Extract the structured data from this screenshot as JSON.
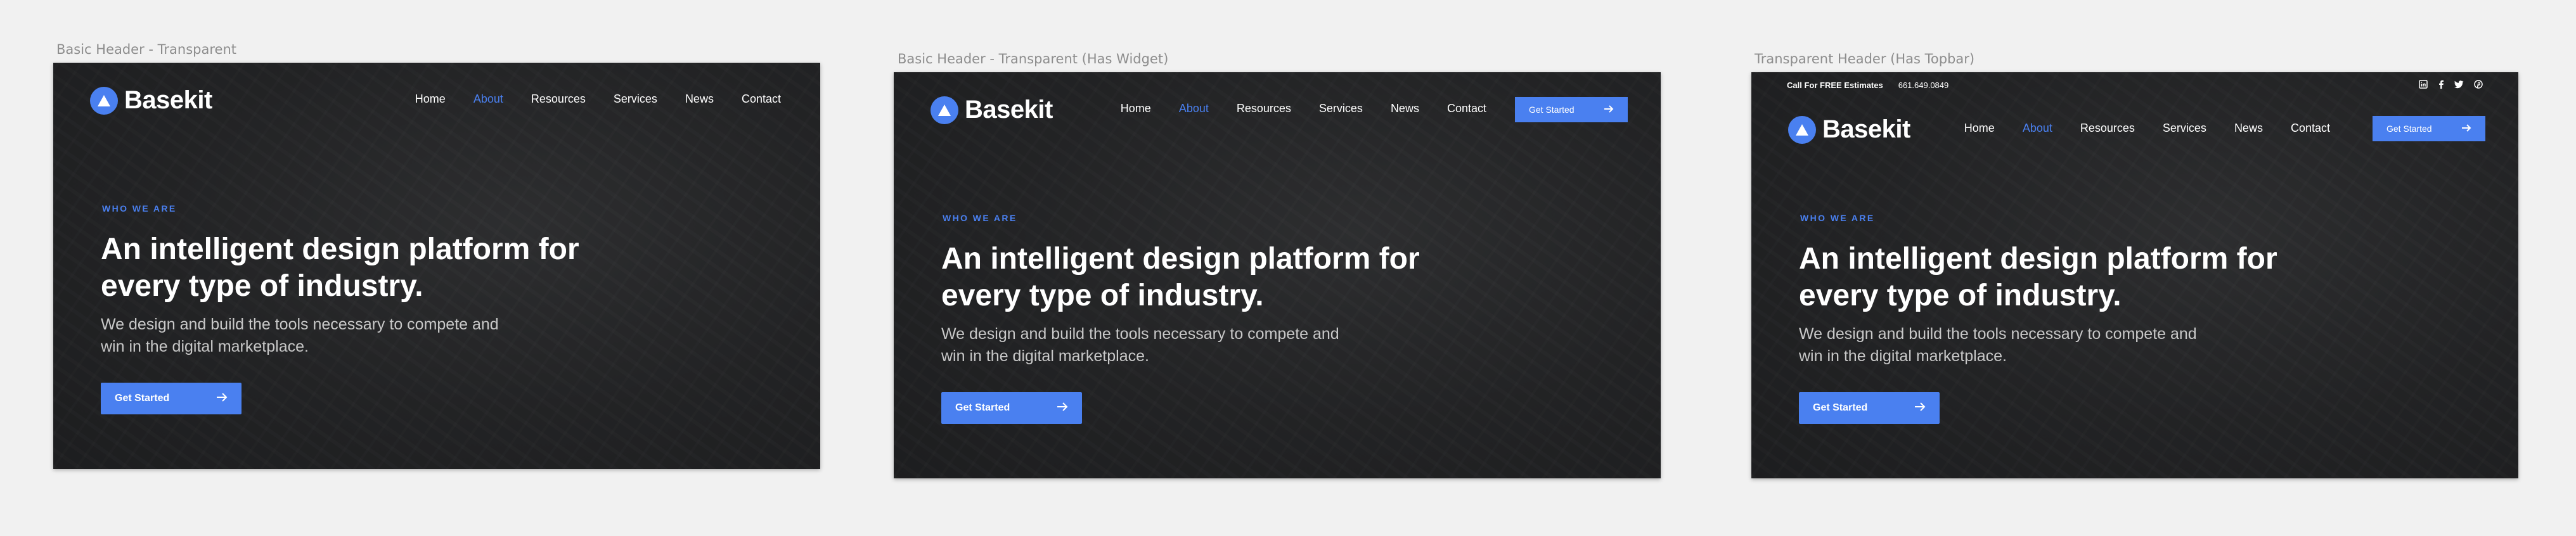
{
  "brand": {
    "name": "Basekit",
    "accent": "#4a80f0"
  },
  "nav": {
    "items": [
      {
        "label": "Home",
        "active": false
      },
      {
        "label": "About",
        "active": true
      },
      {
        "label": "Resources",
        "active": false
      },
      {
        "label": "Services",
        "active": false
      },
      {
        "label": "News",
        "active": false
      },
      {
        "label": "Contact",
        "active": false
      }
    ]
  },
  "hero": {
    "kicker": "WHO WE ARE",
    "headline": "An intelligent design platform for every type of industry.",
    "subtext": "We design and build the tools necessary to compete and win in the digital marketplace.",
    "cta_label": "Get Started",
    "cta_icon": "arrow-right-icon"
  },
  "widget": {
    "label": "Get Started",
    "icon": "arrow-right-icon"
  },
  "topbar": {
    "text": "Call For FREE Estimates",
    "phone": "661.649.0849",
    "socials": [
      "linkedin-icon",
      "facebook-icon",
      "twitter-icon",
      "pinterest-icon"
    ]
  },
  "artboards": [
    {
      "title": "Basic Header - Transparent"
    },
    {
      "title": "Basic Header - Transparent (Has Widget)"
    },
    {
      "title": "Transparent Header (Has Topbar)"
    }
  ]
}
